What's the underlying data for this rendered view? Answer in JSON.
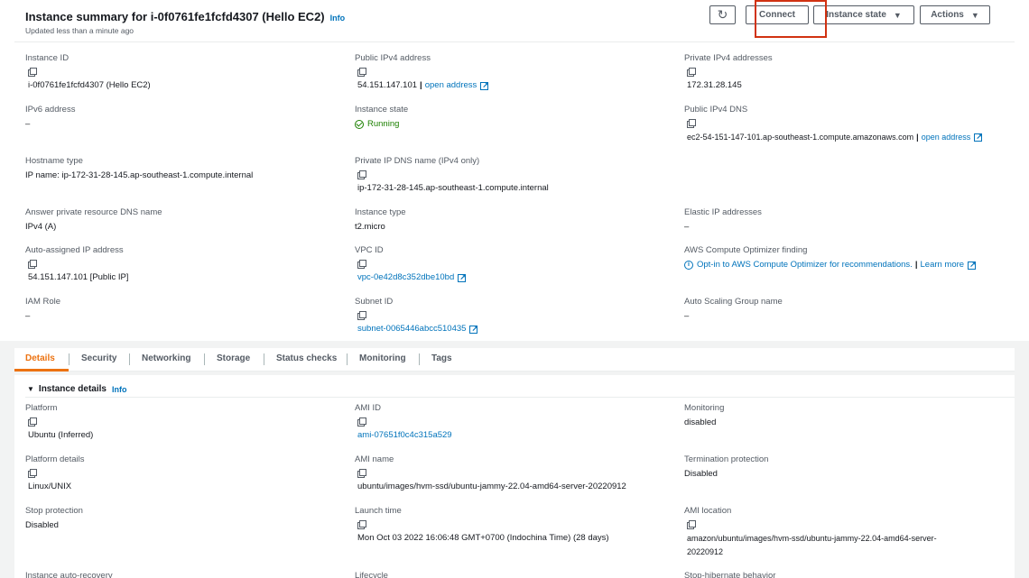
{
  "header": {
    "title": "Instance summary for i-0f0761fe1fcfd4307 (Hello EC2)",
    "info": "Info",
    "updated": "Updated less than a minute ago",
    "buttons": {
      "refresh_icon": "refresh-icon",
      "connect": "Connect",
      "instance_state": "Instance state",
      "actions": "Actions"
    },
    "highlight_color": "#d13212"
  },
  "summary": {
    "instance_id": {
      "label": "Instance ID",
      "value": "i-0f0761fe1fcfd4307 (Hello EC2)"
    },
    "public_ipv4": {
      "label": "Public IPv4 address",
      "value": "54.151.147.101",
      "link": "open address"
    },
    "private_ipv4": {
      "label": "Private IPv4 addresses",
      "value": "172.31.28.145"
    },
    "ipv6": {
      "label": "IPv6 address",
      "value": "–"
    },
    "instance_state": {
      "label": "Instance state",
      "value": "Running"
    },
    "public_dns": {
      "label": "Public IPv4 DNS",
      "value": "ec2-54-151-147-101.ap-southeast-1.compute.amazonaws.com",
      "link": "open address"
    },
    "hostname_type": {
      "label": "Hostname type",
      "value": "IP name: ip-172-31-28-145.ap-southeast-1.compute.internal"
    },
    "private_dns": {
      "label": "Private IP DNS name (IPv4 only)",
      "value": "ip-172-31-28-145.ap-southeast-1.compute.internal"
    },
    "answer_dns": {
      "label": "Answer private resource DNS name",
      "value": "IPv4 (A)"
    },
    "instance_type": {
      "label": "Instance type",
      "value": "t2.micro"
    },
    "elastic_ip": {
      "label": "Elastic IP addresses",
      "value": "–"
    },
    "auto_ip": {
      "label": "Auto-assigned IP address",
      "value": "54.151.147.101 [Public IP]"
    },
    "vpc": {
      "label": "VPC ID",
      "value": "vpc-0e42d8c352dbe10bd"
    },
    "optimizer": {
      "label": "AWS Compute Optimizer finding",
      "value": "Opt-in to AWS Compute Optimizer for recommendations.",
      "link": "Learn more"
    },
    "iam": {
      "label": "IAM Role",
      "value": "–"
    },
    "subnet": {
      "label": "Subnet ID",
      "value": "subnet-0065446abcc510435"
    },
    "asg": {
      "label": "Auto Scaling Group name",
      "value": "–"
    }
  },
  "tabs": [
    "Details",
    "Security",
    "Networking",
    "Storage",
    "Status checks",
    "Monitoring",
    "Tags"
  ],
  "details": {
    "title": "Instance details",
    "info": "Info",
    "platform": {
      "label": "Platform",
      "value": "Ubuntu (Inferred)"
    },
    "ami_id": {
      "label": "AMI ID",
      "value": "ami-07651f0c4c315a529"
    },
    "monitoring": {
      "label": "Monitoring",
      "value": "disabled"
    },
    "platform_details": {
      "label": "Platform details",
      "value": "Linux/UNIX"
    },
    "ami_name": {
      "label": "AMI name",
      "value": "ubuntu/images/hvm-ssd/ubuntu-jammy-22.04-amd64-server-20220912"
    },
    "termination": {
      "label": "Termination protection",
      "value": "Disabled"
    },
    "stop_protection": {
      "label": "Stop protection",
      "value": "Disabled"
    },
    "launch_time": {
      "label": "Launch time",
      "value": "Mon Oct 03 2022 16:06:48 GMT+0700 (Indochina Time) (28 days)"
    },
    "ami_location": {
      "label": "AMI location",
      "value_line1": "amazon/ubuntu/images/hvm-ssd/ubuntu-jammy-22.04-amd64-server-",
      "value_line2": "20220912"
    },
    "auto_recovery": {
      "label": "Instance auto-recovery"
    },
    "lifecycle": {
      "label": "Lifecycle"
    },
    "stop_hibernate": {
      "label": "Stop-hibernate behavior"
    }
  },
  "colors": {
    "link": "#0073bb",
    "running": "#1d8102",
    "active_tab": "#ec7211"
  }
}
